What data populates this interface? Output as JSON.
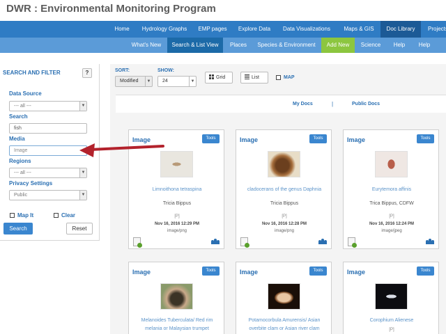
{
  "app": {
    "title": "DWR : Environmental Monitoring Program"
  },
  "nav_primary": [
    {
      "label": "Home",
      "active": false
    },
    {
      "label": "Hydrology Graphs",
      "active": false
    },
    {
      "label": "EMP pages",
      "active": false
    },
    {
      "label": "Explore Data",
      "active": false
    },
    {
      "label": "Data Visualizations",
      "active": false
    },
    {
      "label": "Maps & GIS",
      "active": false
    },
    {
      "label": "Doc Library",
      "active": true
    },
    {
      "label": "Projects",
      "active": false
    }
  ],
  "nav_secondary": [
    {
      "label": "What's New",
      "style": "normal"
    },
    {
      "label": "Search & List View",
      "style": "active"
    },
    {
      "label": "Places",
      "style": "normal"
    },
    {
      "label": "Species & Environment",
      "style": "normal"
    },
    {
      "label": "Add New",
      "style": "green"
    },
    {
      "label": "Science",
      "style": "normal"
    },
    {
      "label": "Help",
      "style": "normal"
    },
    {
      "label": "Help",
      "style": "normal"
    }
  ],
  "sidebar": {
    "heading": "SEARCH AND FILTER",
    "help_label": "?",
    "data_source": {
      "label": "Data Source",
      "value": "--- all ---"
    },
    "search": {
      "label": "Search",
      "value": "fish"
    },
    "media": {
      "label": "Media",
      "placeholder": "Image"
    },
    "regions": {
      "label": "Regions",
      "value": "--- all ---"
    },
    "privacy": {
      "label": "Privacy Settings",
      "value": "Public"
    },
    "map_it_label": "Map It",
    "clear_label": "Clear",
    "search_button": "Search",
    "reset_button": "Reset"
  },
  "controls": {
    "sort_label": "SORT:",
    "sort_value": "Modified",
    "show_label": "SHOW:",
    "show_value": "24",
    "grid_label": "Grid",
    "list_label": "List",
    "map_label": "MAP"
  },
  "doc_tabs": {
    "my_docs": "My Docs",
    "separator": "|",
    "public_docs": "Public Docs"
  },
  "cards": [
    {
      "type": "Image",
      "tools": "Tools",
      "title": "Limnoithona tetraspina",
      "author": "Tricia Bippus",
      "p": "[P]",
      "date": "Nov 16, 2016 12:29 PM",
      "mime": "image/png"
    },
    {
      "type": "Image",
      "tools": "Tools",
      "title": "cladocerans of the genus Daphnia",
      "author": "Tricia Bippus",
      "p": "[P]",
      "date": "Nov 16, 2016 12:28 PM",
      "mime": "image/png"
    },
    {
      "type": "Image",
      "tools": "Tools",
      "title": "Eurytemora affinis",
      "author": "Trica Bippus, CDFW",
      "p": "[P]",
      "date": "Nov 16, 2016 12:24 PM",
      "mime": "image/jpeg"
    },
    {
      "type": "Image",
      "tools": "Tools",
      "title_line1": "Melanoides Tuberculata/ Red rim",
      "title_line2": "melania or Malaysian trumpet"
    },
    {
      "type": "Image",
      "tools": "Tools",
      "title_line1": "Potamocorbula Amurensis/ Asian",
      "title_line2": "overbite clam or Asian river clam"
    },
    {
      "type": "Image",
      "tools": "Tools",
      "title": "Corophium Alienese",
      "p": "[P]"
    }
  ],
  "colors": {
    "nav_primary": "#2f7cc4",
    "nav_secondary": "#5b9bd8",
    "accent": "#2a6fb2",
    "add_new": "#8cc63f",
    "annotation_arrow": "#b3222c"
  }
}
